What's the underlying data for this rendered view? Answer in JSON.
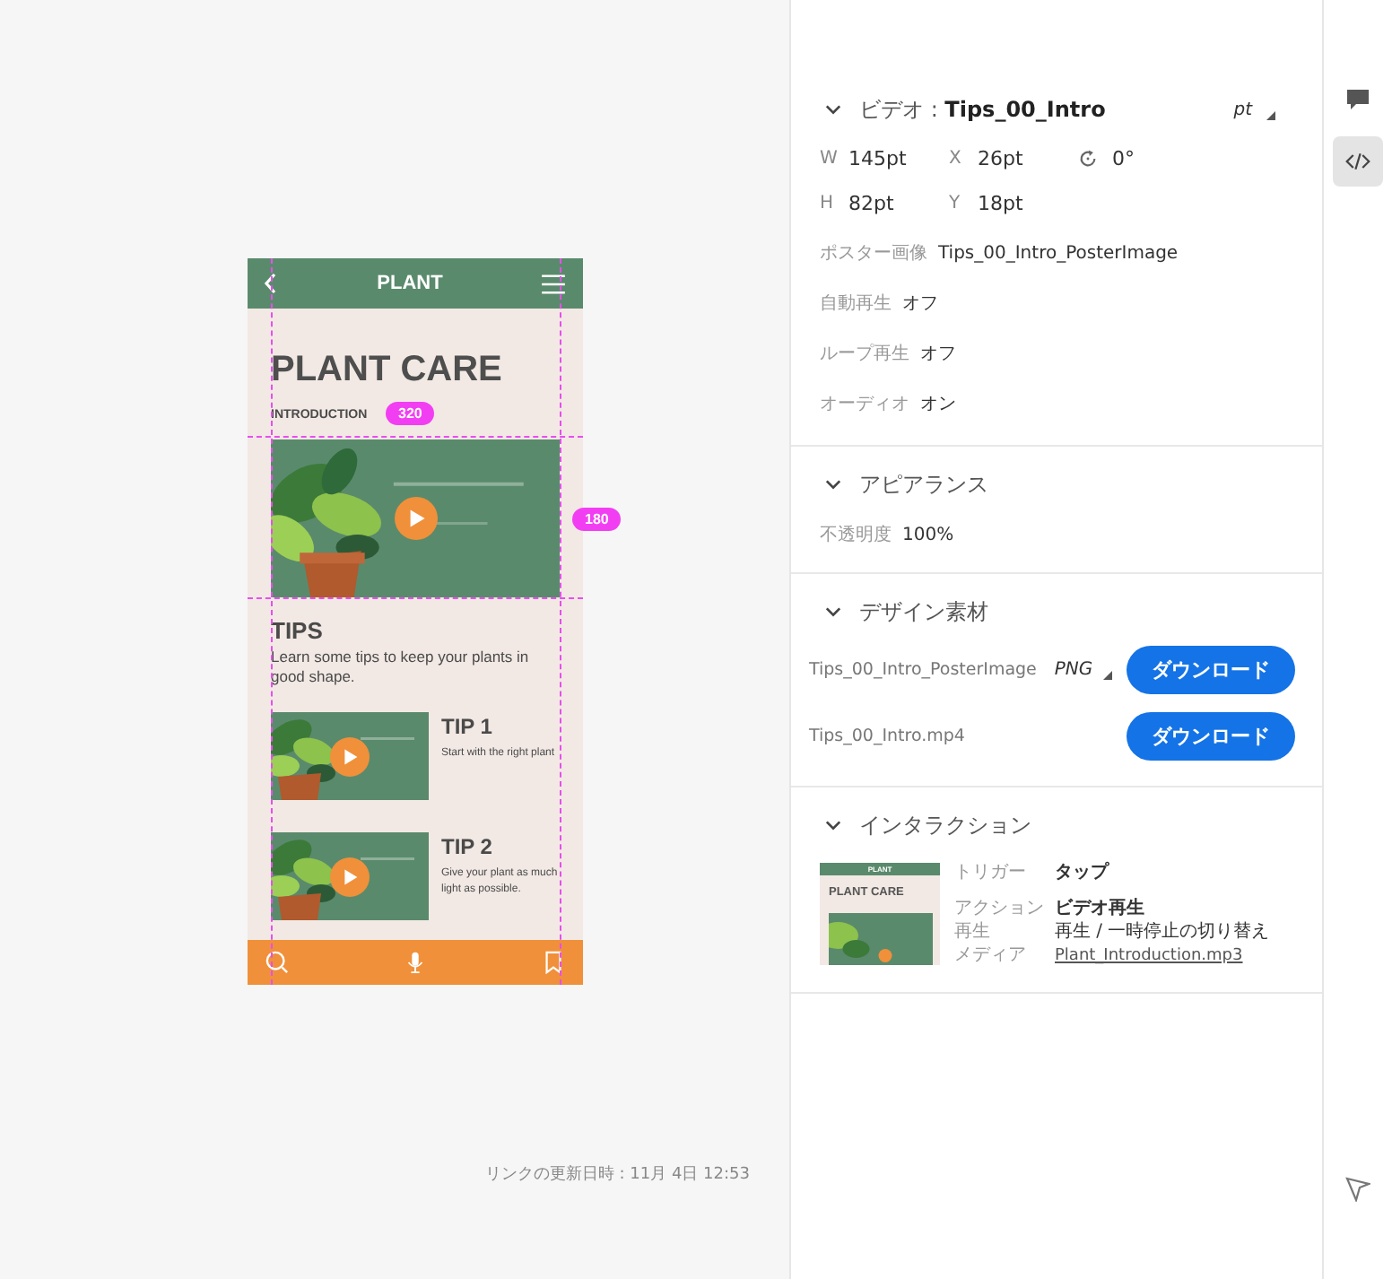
{
  "canvas": {
    "phone": {
      "header": {
        "title": "PLANT"
      },
      "heading": "PLANT CARE",
      "subheading": "INTRODUCTION",
      "tips_heading": "TIPS",
      "tips_text": "Learn some tips to keep your plants in good shape.",
      "tips": [
        {
          "title": "TIP 1",
          "text": "Start with the right plant"
        },
        {
          "title": "TIP 2",
          "text": "Give your plant as much light as possible."
        }
      ]
    },
    "measure_badges": [
      "320",
      "180"
    ],
    "footer": "リンクの更新日時 : 11月 4日 12:53"
  },
  "inspector": {
    "sections": [
      {
        "kind": "video",
        "title": "ビデオ : **Tips_00_Intro**",
        "expanded": true,
        "unit": "pt",
        "dimension_rows": [
          [
            {
              "kind": "field",
              "label": "W",
              "value": "145pt"
            },
            {
              "kind": "field",
              "label": "X",
              "value": "26pt"
            },
            {
              "kind": "rotation",
              "value": "0°"
            }
          ],
          [
            {
              "kind": "field",
              "label": "H",
              "value": "82pt"
            },
            {
              "kind": "field",
              "label": "Y",
              "value": "18pt"
            }
          ]
        ],
        "properties": [
          {
            "label": "ポスター画像",
            "value": "Tips_00_Intro_PosterImage"
          },
          {
            "label": "自動再生",
            "value": "オフ"
          },
          {
            "label": "ループ再生",
            "value": "オフ"
          },
          {
            "label": "オーディオ",
            "value": "オン"
          }
        ]
      },
      {
        "kind": "appearance",
        "title": "アピアランス",
        "expanded": true,
        "properties": [
          {
            "label": "不透明度",
            "value": "100%"
          }
        ]
      },
      {
        "kind": "assets",
        "title": "デザイン素材",
        "expanded": true,
        "assets": [
          {
            "name": "Tips_00_Intro_PosterImage",
            "format": "PNG",
            "button": "ダウンロード"
          },
          {
            "name": "Tips_00_Intro.mp4",
            "button": "ダウンロード"
          }
        ]
      },
      {
        "kind": "interaction",
        "title": "インタラクション",
        "expanded": true,
        "thumbnail": {
          "title": "PLANT",
          "heading": "PLANT CARE"
        },
        "properties": [
          {
            "label": "トリガー",
            "value": "タップ",
            "kind": "bold"
          },
          {
            "label": "アクション",
            "value": "ビデオ再生",
            "kind": "bold"
          },
          {
            "label": "再生",
            "value": "再生 / 一時停止の切り替え",
            "kind": "plain"
          },
          {
            "label": "メディア",
            "value": "Plant_Introduction.mp3",
            "kind": "link"
          }
        ]
      }
    ]
  },
  "toolbar": [
    {
      "kind": "comment",
      "selected": false
    },
    {
      "kind": "code",
      "selected": true
    },
    {
      "kind": "pointer",
      "selected": false
    }
  ]
}
